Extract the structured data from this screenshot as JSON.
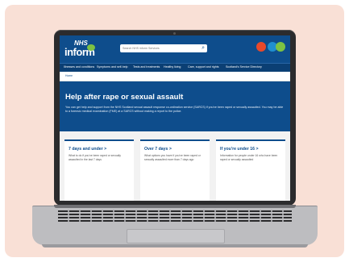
{
  "header": {
    "logo_nhs": "NHS",
    "logo_inform": "inform",
    "search_placeholder": "Search NHS inform Services",
    "icons": [
      "accessibility-icon",
      "translate-icon",
      "bsl-icon"
    ]
  },
  "nav": {
    "items": [
      "Illnesses and conditions",
      "Symptoms and self-help",
      "Tests and treatments",
      "Healthy living",
      "Care, support and rights",
      "Scotland's Service Directory"
    ]
  },
  "breadcrumb": {
    "home": "Home"
  },
  "hero": {
    "title": "Help after rape or sexual assault",
    "text": "You can get help and support from the NHS Scotland sexual assault response co-ordination service (SARCS) if you've been raped or sexually assaulted. You may be able to a forensic medical examination (FME) at a SARCS without making a report to the police."
  },
  "cards": [
    {
      "title": "7 days and under >",
      "text": "What to do if you've been raped or sexually assaulted in the last 7 days"
    },
    {
      "title": "Over 7 days >",
      "text": "What options you have if you've been raped or sexually assaulted more than 7 days ago"
    },
    {
      "title": "If you're under 16 >",
      "text": "Information for people under 16 who have been raped or sexually assaulted"
    }
  ],
  "colors": {
    "brand_blue": "#0e4d8c",
    "nav_blue": "#0b3f74",
    "accent_green": "#7dc243",
    "accent_red": "#e8492b",
    "background_peach": "#f9e0d6"
  }
}
